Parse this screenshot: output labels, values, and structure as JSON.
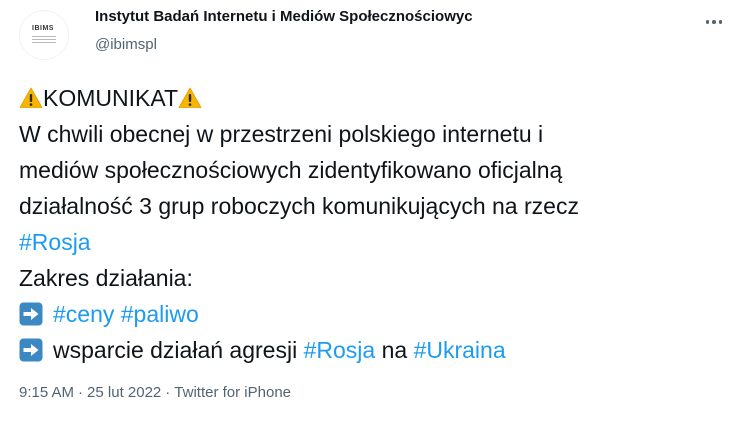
{
  "author": {
    "display_name": "Instytut Badań Internetu i Mediów Społecznościowyc",
    "handle": "@ibimspl",
    "avatar_text": "IBIMS"
  },
  "tweet": {
    "title_text": "KOMUNIKAT",
    "text_line1": "W chwili obecnej w przestrzeni polskiego internetu i",
    "text_line2": "mediów społecznościowych zidentyfikowano oficjalną",
    "text_line3": "działalność 3 grup roboczych komunikujących na rzecz",
    "hashtag_rosja_1": "#Rosja",
    "scope_label": "Zakres działania:",
    "hashtag_ceny": "#ceny",
    "hashtag_paliwo": "#paliwo",
    "support_text": "wsparcie działań agresji",
    "hashtag_rosja_2": "#Rosja",
    "na_text": "na",
    "hashtag_ukraina": "#Ukraina"
  },
  "meta": {
    "time": "9:15 AM",
    "separator": "·",
    "date": "25 lut 2022",
    "source": "Twitter for iPhone"
  },
  "icons": {
    "warning": "warning-icon",
    "arrow": "right-arrow-icon",
    "more": "more-icon"
  },
  "colors": {
    "hashtag": "#1d9bf0",
    "secondary_text": "#536471",
    "primary_text": "#0f1419",
    "warning_fill": "#f7b500",
    "arrow_box": "#3b88c3"
  }
}
